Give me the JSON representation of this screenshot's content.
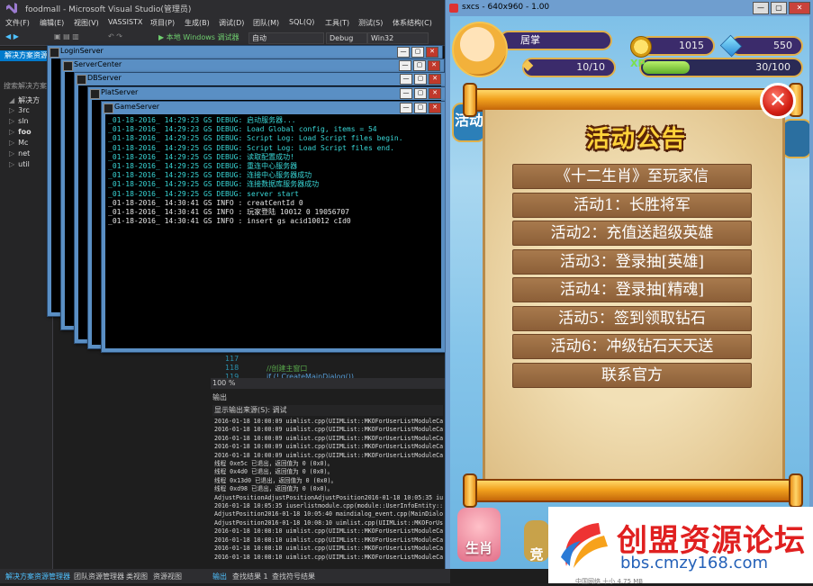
{
  "vs": {
    "title": "foodmall - Microsoft Visual Studio(管理员)",
    "menu": [
      "文件(F)",
      "编辑(E)",
      "视图(V)",
      "VASSISTX",
      "项目(P)",
      "生成(B)",
      "调试(D)",
      "团队(M)",
      "SQL(Q)",
      "工具(T)",
      "测试(S)",
      "体系结构(C)"
    ],
    "toolbar": {
      "debugger": "▶ 本地 Windows 调试器",
      "config_auto": "自动",
      "config": "Debug",
      "platform": "Win32"
    },
    "solution_explorer": {
      "header": "解决方案资源管理器",
      "search_placeholder": "搜索解决方案",
      "items": [
        "解决方",
        "3rc",
        "sln",
        "foo",
        "Mc",
        "net",
        "util"
      ]
    },
    "code": {
      "lines": [
        "117",
        "118",
        "119"
      ],
      "comment": "//创建主窗口",
      "code_line": "if (! CreateMainDialog())",
      "zoom": "100 %"
    },
    "output": {
      "title": "输出",
      "source_label": "显示输出来源(S):  调试",
      "lines": [
        "2016-01-18 10:00:09 uimlist.cpp(UIIMList::MKOForUserListModuleCal",
        "2016-01-18 10:00:09 uimlist.cpp(UIIMList::MKOForUserListModuleCal",
        "2016-01-18 10:00:09 uimlist.cpp(UIIMList::MKOForUserListModuleCal",
        "2016-01-18 10:00:09 uimlist.cpp(UIIMList::MKOForUserListModuleCal",
        "2016-01-18 10:00:09 uimlist.cpp(UIIMList::MKOForUserListModuleCal",
        "线程 0xe5c 已退出，返回值为 0 (0x0)。",
        "线程 0x4d0 已退出，返回值为 0 (0x0)。",
        "线程 0x13d0 已退出，返回值为 0 (0x0)。",
        "线程 0xd98 已退出，返回值为 0 (0x0)。",
        "AdjustPositionAdjustPositionAdjustPosition2016-01-18 10:05:35 iuserli",
        "2016-01-18 10:05:35 iuserlistmodule.cpp(module::UserInfoEntity::ge",
        "AdjustPosition2016-01-18 10:05:40 maindialog_event.cpp(MainDialog:",
        "AdjustPosition2016-01-18 10:08:10 uimlist.cpp(UIIMList::MKOForUser",
        "2016-01-18 10:08:10 uimlist.cpp(UIIMList::MKOForUserListModuleCal",
        "2016-01-18 10:08:10 uimlist.cpp(UIIMList::MKOForUserListModuleCal",
        "2016-01-18 10:08:10 uimlist.cpp(UIIMList::MKOForUserListModuleCal",
        "2016-01-18 10:08:10 uimlist.cpp(UIIMList::MKOForUserListModuleCal"
      ]
    },
    "bottom_tabs": [
      "解决方案资源管理器",
      "团队资源管理器",
      "类视图",
      "资源视图",
      "输出",
      "查找结果 1",
      "查找符号结果"
    ]
  },
  "servers": {
    "windows": [
      "LoginServer",
      "ServerCenter",
      "DBServer",
      "PlatServer",
      "GameServer"
    ],
    "console": [
      {
        "text": "_01-18-2016_ 14:29:23 GS DEBUG:  启动服务器...",
        "color": "#39d6d6"
      },
      {
        "text": "_01-18-2016_ 14:29:23 GS DEBUG:  Load Global config, items = 54",
        "color": "#39d6d6"
      },
      {
        "text": "_01-18-2016_ 14:29:25 GS DEBUG:  Script Log: Load Script files begin.",
        "color": "#39d6d6"
      },
      {
        "text": "_01-18-2016_ 14:29:25 GS DEBUG:  Script Log: Load Script files end.",
        "color": "#39d6d6"
      },
      {
        "text": "_01-18-2016_ 14:29:25 GS DEBUG:  读取配置成功!",
        "color": "#39d6d6"
      },
      {
        "text": "_01-18-2016_ 14:29:25 GS DEBUG:  重连中心服务器",
        "color": "#39d6d6"
      },
      {
        "text": "_01-18-2016_ 14:29:25 GS DEBUG:  连接中心服务器成功",
        "color": "#39d6d6"
      },
      {
        "text": "_01-18-2016_ 14:29:25 GS DEBUG:  连接数据库服务器成功",
        "color": "#39d6d6"
      },
      {
        "text": "_01-18-2016_ 14:29:25 GS DEBUG:  server start",
        "color": "#39d6d6"
      },
      {
        "text": "_01-18-2016_ 14:30:41 GS INFO :  creatCentId  0",
        "color": "#e6e6e6"
      },
      {
        "text": "_01-18-2016_ 14:30:41 GS INFO :  玩家登陆   10012  0  19056707",
        "color": "#e6e6e6"
      },
      {
        "text": "_01-18-2016_ 14:30:41 GS INFO :  insert  gs  acid10012  cId0",
        "color": "#e6e6e6"
      }
    ]
  },
  "game": {
    "window_title": "sxcs - 640x960 - 1.00",
    "player_name": "居掌",
    "coins": "1015",
    "gems": "550",
    "stamina": "10/10",
    "xp_label": "XP",
    "xp": "30/100",
    "xp_progress": 0.3,
    "notice_title": "活动公告",
    "activities": [
      "《十二生肖》至玩家信",
      "活动1：长胜将军",
      "活动2：充值送超级英雄",
      "活动3：登录抽[英雄]",
      "活动4：登录抽[精魂]",
      "活动5：签到领取钻石",
      "活动6：冲级钻石天天送",
      "联系官方"
    ],
    "side_left": "活动",
    "bottom_left": "生肖",
    "bottom_mid": "竞"
  },
  "watermark": {
    "brand": "创盟资源论坛",
    "url": "bbs.cmzy168.com",
    "fragment": "中国网络          十小  4.75 MB"
  }
}
